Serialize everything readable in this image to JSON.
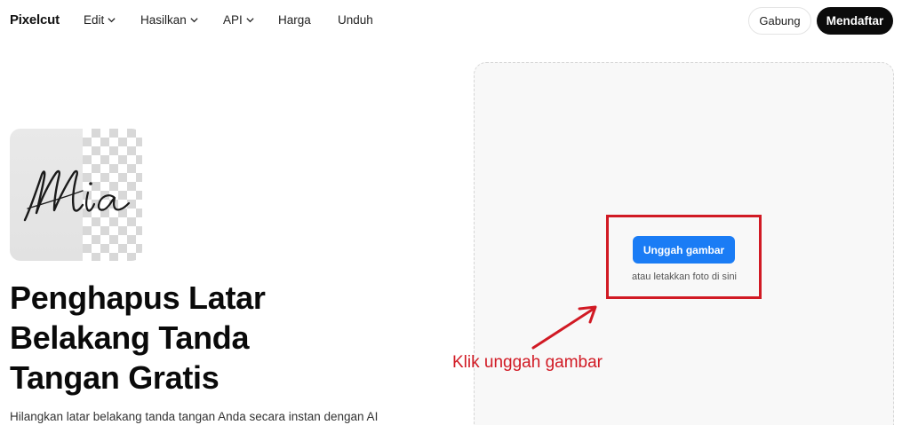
{
  "nav": {
    "logo": "Pixelcut",
    "items": [
      {
        "label": "Edit",
        "has_dropdown": true
      },
      {
        "label": "Hasilkan",
        "has_dropdown": true
      },
      {
        "label": "API",
        "has_dropdown": true
      },
      {
        "label": "Harga",
        "has_dropdown": false
      },
      {
        "label": "Unduh",
        "has_dropdown": false
      }
    ],
    "login_label": "Gabung",
    "signup_label": "Mendaftar"
  },
  "hero": {
    "image_signature_text": "Mia",
    "title": "Penghapus Latar Belakang Tanda Tangan Gratis",
    "subtitle": "Hilangkan latar belakang tanda tangan Anda secara instan dengan AI"
  },
  "upload": {
    "button_label": "Unggah gambar",
    "drop_hint": "atau letakkan foto di sini"
  },
  "annotation": {
    "text": "Klik unggah gambar",
    "color": "#d11a24"
  },
  "colors": {
    "primary_button": "#1a7cf5",
    "signup_button": "#0b0b0b"
  }
}
